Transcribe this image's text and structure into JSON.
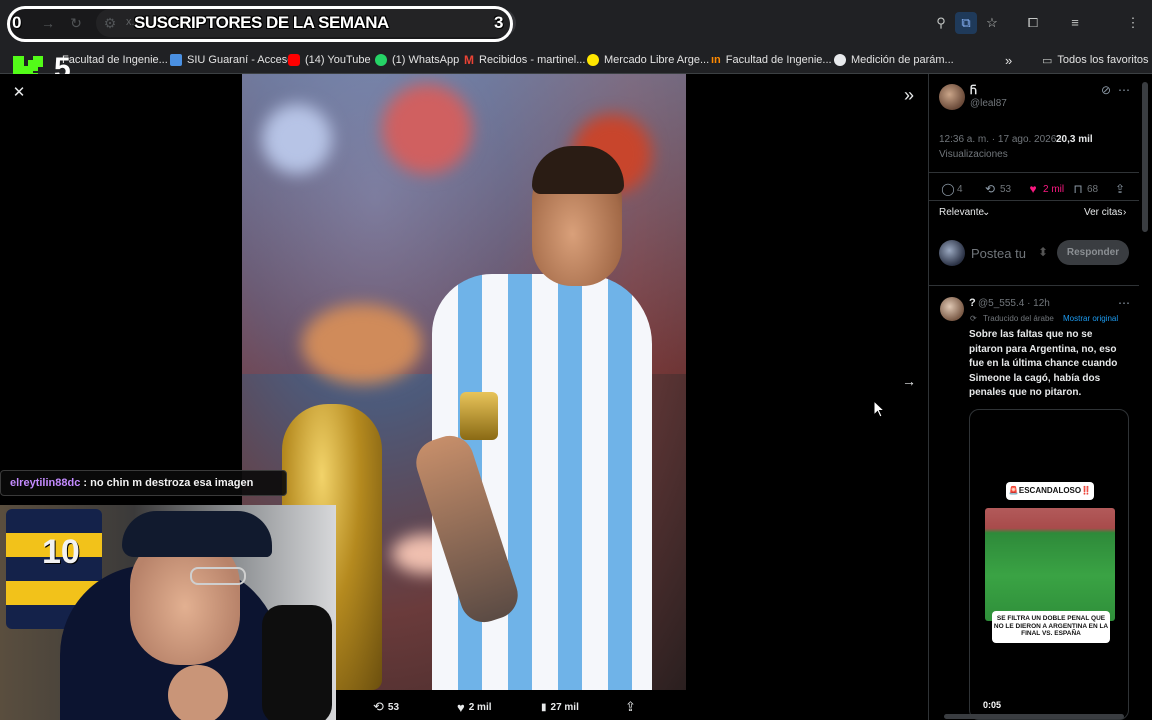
{
  "overlay": {
    "banner_title": "SUSCRIPTORES DE LA SEMANA",
    "banner_left": "0",
    "banner_right": "3",
    "logo_number": "5"
  },
  "browser": {
    "url_text": "x.",
    "bookmarks": [
      {
        "label": "Facultad de Ingenie...",
        "color": "#f28b82"
      },
      {
        "label": "SIU Guaraní - Acceso",
        "color": "#4a90e2"
      },
      {
        "label": "(14) YouTube",
        "color": "#ff0000"
      },
      {
        "label": "(1) WhatsApp",
        "color": "#25d366"
      },
      {
        "label": "Recibidos - martinel...",
        "color": "#ea4335"
      },
      {
        "label": "Mercado Libre Arge...",
        "color": "#ffe600"
      },
      {
        "label": "Facultad de Ingenie...",
        "color": "#ff8a00"
      },
      {
        "label": "Medición de parám...",
        "color": "#e8eaed"
      }
    ],
    "more_bookmarks": "»",
    "all_favorites": "Todos los favoritos"
  },
  "viewer": {
    "actions": [
      {
        "icon": "retweet-icon",
        "glyph": "⟲",
        "count": "53"
      },
      {
        "icon": "heart-icon",
        "glyph": "♥",
        "count": "2 mil"
      },
      {
        "icon": "views-icon",
        "glyph": "▮",
        "count": "27 mil"
      },
      {
        "icon": "share-icon",
        "glyph": "⇪",
        "count": ""
      }
    ]
  },
  "chat": {
    "user": "elreytilin88dc",
    "text": ": no chin m destroza esa imagen"
  },
  "tweet": {
    "author_name": "Ⴌ",
    "handle": "@leal87",
    "timestamp": "12:36 a. m. · 17 ago. 2026 ·",
    "views_count": "20,3 mil",
    "views_label": "Visualizaciones",
    "replies": "4",
    "retweets": "53",
    "likes": "2 mil",
    "bookmarks": "68",
    "sort_label": "Relevante",
    "quotes_label": "Ver citas",
    "reply_placeholder": "Postea tu",
    "reply_button": "Responder"
  },
  "reply": {
    "author": "?",
    "handle": "@5_555.4 · 12h",
    "translated": "Traducido del árabe",
    "show_original": "Mostrar original",
    "body": "Sobre las faltas que no se pitaron para Argentina, no, eso fue en la última chance cuando Simeone la cagó, había dos penales que no pitaron.",
    "video_label": "🚨ESCANDALOSO‼️",
    "video_caption": "SE FILTRA UN DOBLE PENAL QUE NO LE DIERON A ARGENTINA EN LA FINAL VS. ESPAÑA",
    "video_time": "0:05"
  },
  "colors": {
    "like_pink": "#f91880",
    "link_blue": "#1d9bf0",
    "chat_user": "#c48bff",
    "kick_green": "#53fc18"
  }
}
